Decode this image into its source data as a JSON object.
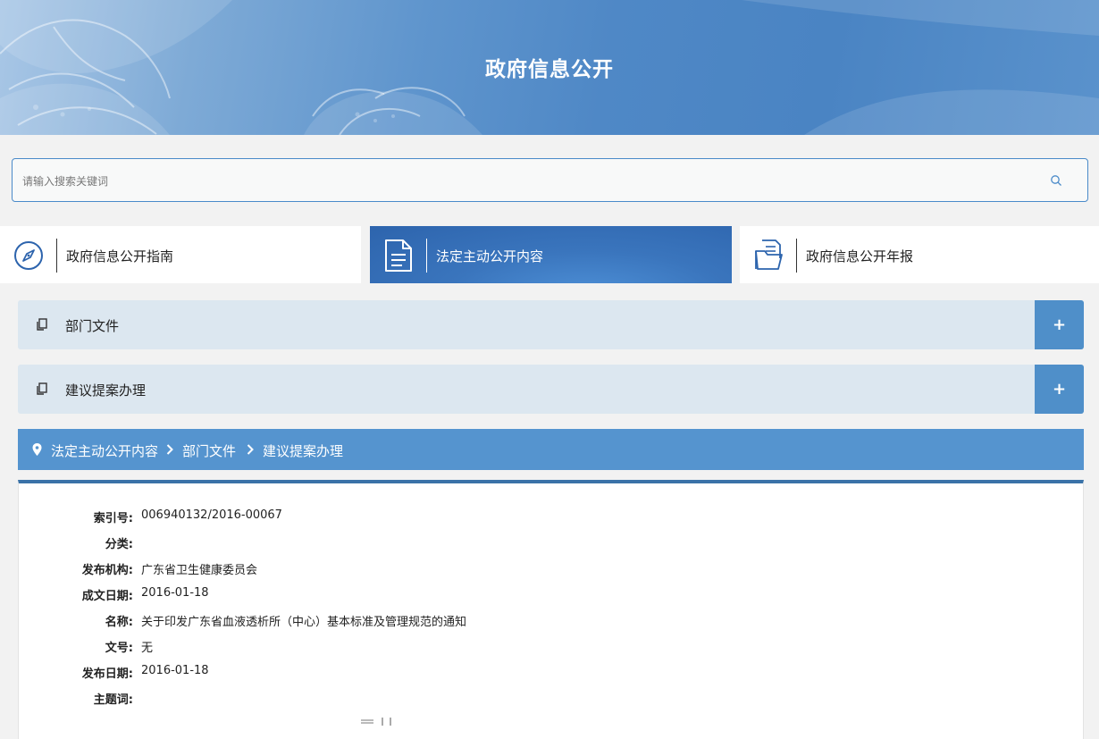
{
  "banner": {
    "title": "政府信息公开"
  },
  "search": {
    "placeholder": "请输入搜索关键词",
    "icon": "search-icon"
  },
  "tabs": [
    {
      "label": "政府信息公开指南",
      "icon": "compass-icon",
      "active": false
    },
    {
      "label": "法定主动公开内容",
      "icon": "document-icon",
      "active": true
    },
    {
      "label": "政府信息公开年报",
      "icon": "folder-icon",
      "active": false
    }
  ],
  "accordions": [
    {
      "label": "部门文件",
      "icon": "copy-icon",
      "toggle": "+"
    },
    {
      "label": "建议提案办理",
      "icon": "copy-icon",
      "toggle": "+"
    }
  ],
  "breadcrumb": {
    "icon": "location-pin-icon",
    "items": [
      "法定主动公开内容",
      "部门文件",
      "建议提案办理"
    ]
  },
  "details": [
    {
      "key": "索引号:",
      "value": "006940132/2016-00067"
    },
    {
      "key": "分类:",
      "value": ""
    },
    {
      "key": "发布机构:",
      "value": "广东省卫生健康委员会"
    },
    {
      "key": "成文日期:",
      "value": "2016-01-18"
    },
    {
      "key": "名称:",
      "value": "关于印发广东省血液透析所（中心）基本标准及管理规范的通知"
    },
    {
      "key": "文号:",
      "value": "无"
    },
    {
      "key": "发布日期:",
      "value": "2016-01-18"
    },
    {
      "key": "主题词:",
      "value": ""
    }
  ],
  "colors": {
    "accent": "#5594cf",
    "tab_active": "#2d64ad",
    "accordion_bg": "#dce7f0",
    "panel_border": "#3a72a8"
  }
}
